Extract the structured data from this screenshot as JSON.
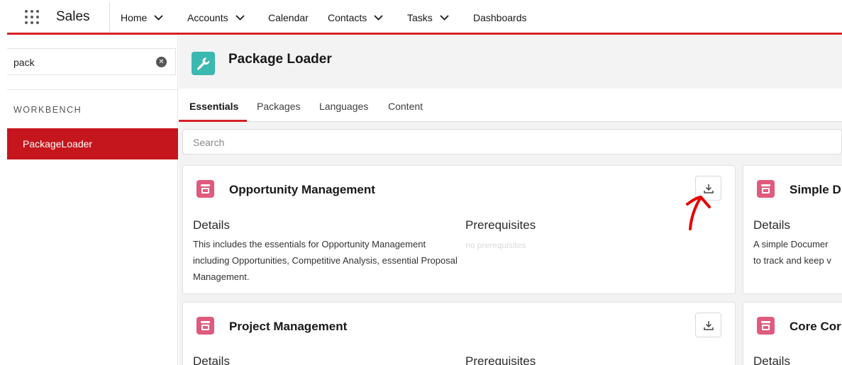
{
  "app": {
    "name": "Sales"
  },
  "nav": {
    "items": [
      {
        "label": "Home",
        "has_menu": true
      },
      {
        "label": "Accounts",
        "has_menu": true
      },
      {
        "label": "Calendar",
        "has_menu": false
      },
      {
        "label": "Contacts",
        "has_menu": true
      },
      {
        "label": "Tasks",
        "has_menu": true
      },
      {
        "label": "Dashboards",
        "has_menu": false
      }
    ]
  },
  "sidebar": {
    "search_value": "pack",
    "section_label": "WORKBENCH",
    "items": [
      {
        "label": "PackageLoader",
        "selected": true
      }
    ]
  },
  "page": {
    "title": "Package Loader",
    "icon": "wrench-icon",
    "tabs": [
      {
        "label": "Essentials",
        "active": true
      },
      {
        "label": "Packages",
        "active": false
      },
      {
        "label": "Languages",
        "active": false
      },
      {
        "label": "Content",
        "active": false
      }
    ],
    "search_placeholder": "Search"
  },
  "cards": [
    {
      "title": "Opportunity Management",
      "details_label": "Details",
      "description": "This includes the essentials for Opportunity Management including Opportunities, Competitive Analysis, essential Proposal Management.",
      "prereq_label": "Prerequisites",
      "prereq_value": "no prerequisites"
    },
    {
      "title": "Simple D",
      "details_label": "Details",
      "description_line1": "A simple Documer",
      "description_line2": "to track and keep v"
    },
    {
      "title": "Project Management",
      "details_label": "Details",
      "prereq_label": "Prerequisites"
    },
    {
      "title": "Core Cor",
      "details_label": "Details"
    }
  ],
  "colors": {
    "accent_red": "#d62027",
    "selected_bg": "#c4161c",
    "page_icon_bg": "#3bb8b0",
    "package_icon_bg": "#e05a7d",
    "annotation": "#e60000"
  },
  "icons": {
    "app_launcher": "waffle-icon",
    "clear_search": "clear-icon",
    "download": "download-icon",
    "package": "package-icon",
    "annotation": "arrow-annotation"
  }
}
